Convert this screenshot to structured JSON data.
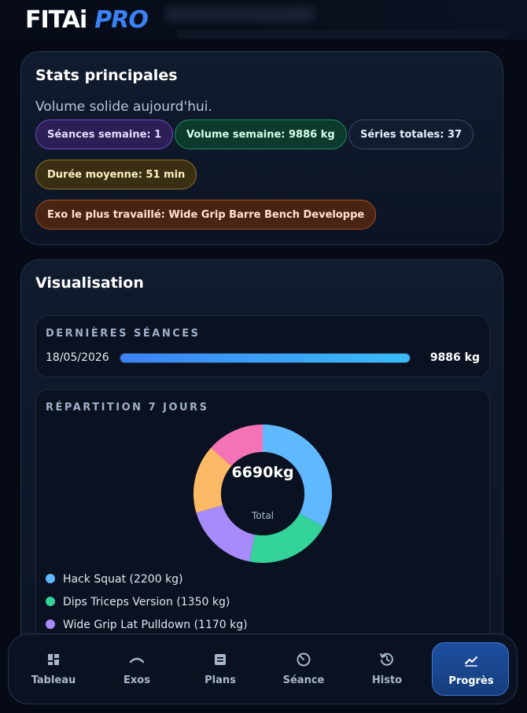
{
  "brand": {
    "name_main": "FITAi",
    "name_accent": "PRO"
  },
  "stats": {
    "title": "Stats principales",
    "subtitle": "Volume solide aujourd'hui.",
    "pills": {
      "sessions": "Séances semaine: 1",
      "volume": "Volume semaine: 9886 kg",
      "sets": "Séries totales: 37",
      "duration": "Durée moyenne: 51 min",
      "top_exercise": "Exo le plus travaillé: Wide Grip Barre Bench Developpe"
    }
  },
  "visualisation": {
    "title": "Visualisation",
    "recent": {
      "label": "DERNIÈRES SÉANCES",
      "date": "18/05/2026",
      "value": "9886 kg",
      "progress": 1.0
    },
    "distribution": {
      "label": "RÉPARTITION 7 JOURS",
      "total_value": "6690kg",
      "total_label": "Total",
      "segments": [
        {
          "name": "Hack Squat (2200 kg)",
          "value": 2200,
          "color": "#60b8ff"
        },
        {
          "name": "Dips Triceps Version (1350 kg)",
          "value": 1350,
          "color": "#34d399"
        },
        {
          "name": "Wide Grip Lat Pulldown (1170 kg)",
          "value": 1170,
          "color": "#a78bfa"
        },
        {
          "value": 1070,
          "color": "#fdba66"
        },
        {
          "value": 900,
          "color": "#f472b6"
        }
      ]
    }
  },
  "nav": {
    "items": [
      {
        "label": "Tableau",
        "icon": "dashboard-icon"
      },
      {
        "label": "Exos",
        "icon": "barbell-icon"
      },
      {
        "label": "Plans",
        "icon": "plans-icon"
      },
      {
        "label": "Séance",
        "icon": "timer-icon"
      },
      {
        "label": "Histo",
        "icon": "history-icon"
      },
      {
        "label": "Progrès",
        "icon": "chart-line-icon"
      }
    ],
    "active": "Progrès"
  }
}
